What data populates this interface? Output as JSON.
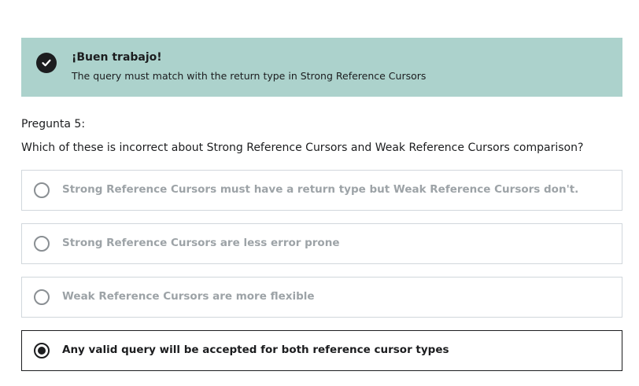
{
  "feedback": {
    "title": "¡Buen trabajo!",
    "message": "The query must match with the return type in Strong Reference Cursors",
    "icon": "check-circle-icon",
    "background": "#acd2cc"
  },
  "question": {
    "number_label": "Pregunta 5:",
    "text": "Which of these is incorrect about Strong Reference Cursors and Weak Reference Cursors comparison?"
  },
  "options": [
    {
      "label": "Strong Reference Cursors must have a return type but Weak Reference Cursors don't.",
      "selected": false,
      "disabled": true
    },
    {
      "label": "Strong Reference Cursors are less error prone",
      "selected": false,
      "disabled": true
    },
    {
      "label": "Weak Reference Cursors are more flexible",
      "selected": false,
      "disabled": true
    },
    {
      "label": "Any valid query will be accepted for both reference cursor types",
      "selected": true,
      "disabled": false
    }
  ]
}
